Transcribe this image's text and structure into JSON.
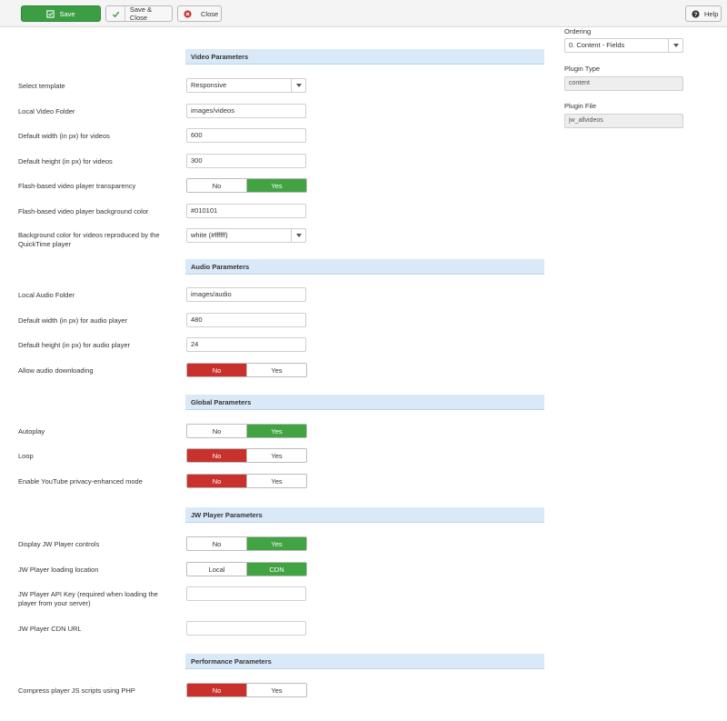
{
  "toolbar": {
    "save": "Save",
    "save_close": "Save & Close",
    "close": "Close",
    "help": "Help",
    "colors": {
      "save_bg": "#3c9e42",
      "close_icon": "#c8312c"
    }
  },
  "sections": {
    "video": "Video Parameters",
    "audio": "Audio Parameters",
    "global": "Global Parameters",
    "jw": "JW Player Parameters",
    "performance": "Performance Parameters"
  },
  "video": {
    "template_label": "Select template",
    "template_value": "Responsive",
    "folder_label": "Local Video Folder",
    "folder_value": "images/videos",
    "width_label": "Default width (in px) for videos",
    "width_value": "600",
    "height_label": "Default height (in px) for videos",
    "height_value": "300",
    "transparency_label": "Flash-based video player transparency",
    "transparency_options": [
      "No",
      "Yes"
    ],
    "transparency_selected": "Yes",
    "bgcolor_label": "Flash-based video player background color",
    "bgcolor_value": "#010101",
    "qt_bg_label": "Background color for videos reproduced by the QuickTime player",
    "qt_bg_value": "white (#ffffff)"
  },
  "audio": {
    "folder_label": "Local Audio Folder",
    "folder_value": "images/audio",
    "width_label": "Default width (in px) for audio player",
    "width_value": "480",
    "height_label": "Default height (in px) for audio player",
    "height_value": "24",
    "download_label": "Allow audio downloading",
    "download_options": [
      "No",
      "Yes"
    ],
    "download_selected": "No"
  },
  "global": {
    "autoplay_label": "Autoplay",
    "autoplay_options": [
      "No",
      "Yes"
    ],
    "autoplay_selected": "Yes",
    "loop_label": "Loop",
    "loop_options": [
      "No",
      "Yes"
    ],
    "loop_selected": "No",
    "youtube_label": "Enable YouTube privacy-enhanced mode",
    "youtube_options": [
      "No",
      "Yes"
    ],
    "youtube_selected": "No"
  },
  "jw": {
    "controls_label": "Display JW Player controls",
    "controls_options": [
      "No",
      "Yes"
    ],
    "controls_selected": "Yes",
    "location_label": "JW Player loading location",
    "location_options": [
      "Local",
      "CDN"
    ],
    "location_selected": "CDN",
    "apikey_label": "JW Player API Key (required when loading the player from your server)",
    "apikey_value": "",
    "cdn_label": "JW Player CDN URL",
    "cdn_value": ""
  },
  "performance": {
    "compress_label": "Compress player JS scripts using PHP",
    "compress_options": [
      "No",
      "Yes"
    ],
    "compress_selected": "No"
  },
  "sidebar": {
    "ordering_label": "Ordering",
    "ordering_value": "0. Content - Fields",
    "type_label": "Plugin Type",
    "type_value": "content",
    "file_label": "Plugin File",
    "file_value": "jw_allvideos"
  }
}
